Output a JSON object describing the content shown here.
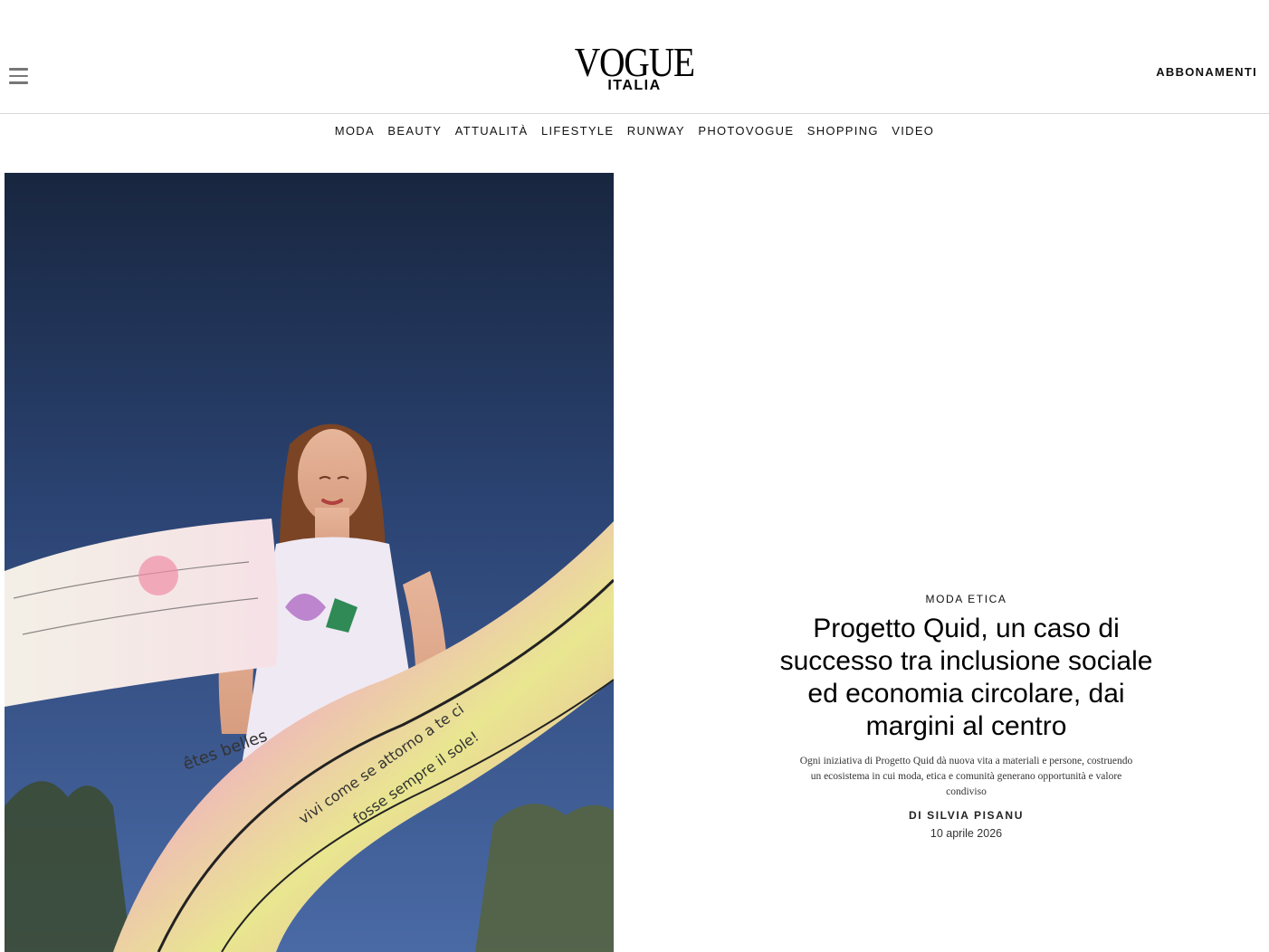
{
  "header": {
    "brand": "VOGUE",
    "brand_sub": "ITALIA",
    "subscribe_label": "ABBONAMENTI",
    "menu_icon": "hamburger-menu-icon"
  },
  "nav": {
    "items": [
      "MODA",
      "BEAUTY",
      "ATTUALITÀ",
      "LIFESTYLE",
      "RUNWAY",
      "PHOTOVOGUE",
      "SHOPPING",
      "VIDEO"
    ]
  },
  "article": {
    "category": "MODA ETICA",
    "title": "Progetto Quid, un caso di successo tra inclusione sociale ed economia circolare, dai margini al centro",
    "dek": "Ogni iniziativa di Progetto Quid dà nuova vita a materiali e persone, costruendo un ecosistema in cui moda, etica e comunità generano opportunità e valore condiviso",
    "byline": "DI SILVIA PISANU",
    "date": "10 aprile 2026"
  },
  "colors": {
    "sky_top": "#1a2a47",
    "sky_bottom": "#3e5f99",
    "scarf_pink": "#f1b9c4",
    "scarf_yellow": "#e6e88a"
  }
}
